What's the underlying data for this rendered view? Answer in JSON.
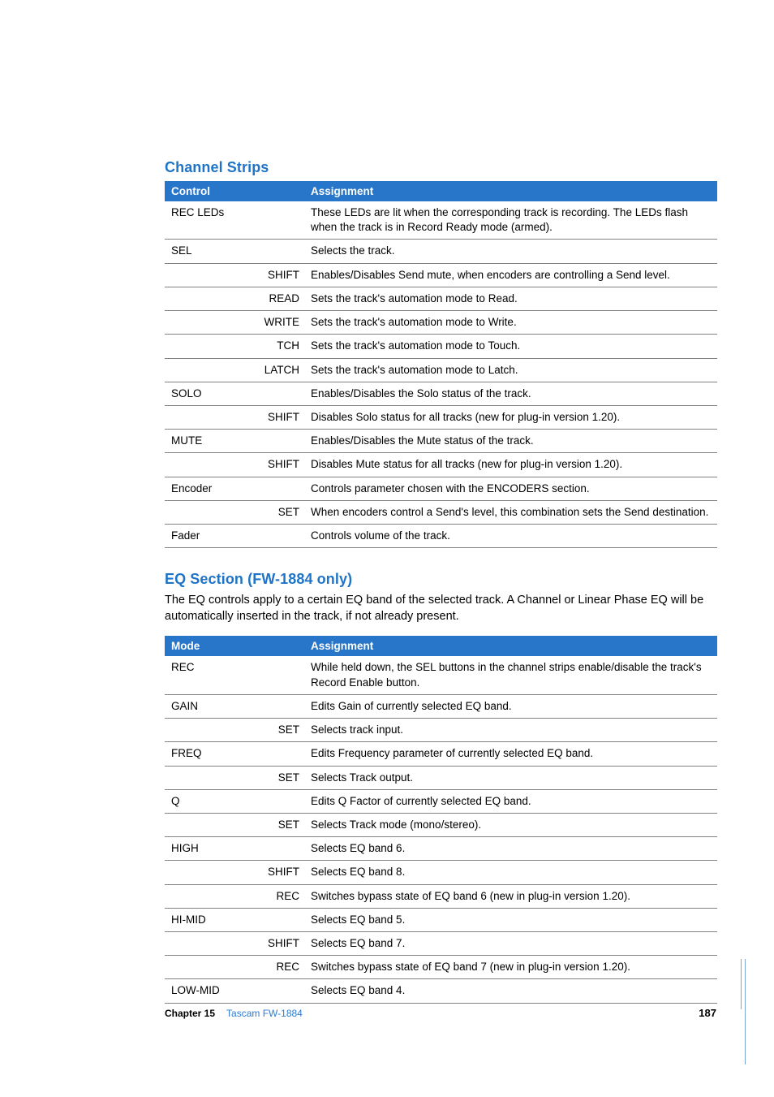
{
  "section1": {
    "heading": "Channel Strips",
    "headers": {
      "control": "Control",
      "assignment": "Assignment"
    },
    "rows": [
      {
        "control": "REC LEDs",
        "mod": "",
        "assignment": "These LEDs are lit when the corresponding track is recording. The LEDs flash when the track is in Record Ready mode (armed)."
      },
      {
        "control": "SEL",
        "mod": "",
        "assignment": "Selects the track."
      },
      {
        "control": "",
        "mod": "SHIFT",
        "assignment": "Enables/Disables Send mute, when encoders are controlling a Send level."
      },
      {
        "control": "",
        "mod": "READ",
        "assignment": "Sets the track's automation mode to Read."
      },
      {
        "control": "",
        "mod": "WRITE",
        "assignment": "Sets the track's automation mode to Write."
      },
      {
        "control": "",
        "mod": "TCH",
        "assignment": "Sets the track's automation mode to Touch."
      },
      {
        "control": "",
        "mod": "LATCH",
        "assignment": "Sets the track's automation mode to Latch."
      },
      {
        "control": "SOLO",
        "mod": "",
        "assignment": "Enables/Disables the Solo status of the track."
      },
      {
        "control": "",
        "mod": "SHIFT",
        "assignment": "Disables Solo status for all tracks (new for plug-in version 1.20)."
      },
      {
        "control": "MUTE",
        "mod": "",
        "assignment": "Enables/Disables the Mute status of the track."
      },
      {
        "control": "",
        "mod": "SHIFT",
        "assignment": "Disables Mute status for all tracks (new for plug-in version 1.20)."
      },
      {
        "control": "Encoder",
        "mod": "",
        "assignment": "Controls parameter chosen with the ENCODERS section."
      },
      {
        "control": "",
        "mod": "SET",
        "assignment": "When encoders control a Send's level, this combination sets the Send destination."
      },
      {
        "control": "Fader",
        "mod": "",
        "assignment": "Controls volume of the track."
      }
    ]
  },
  "section2": {
    "heading": "EQ Section (FW-1884 only)",
    "intro": "The EQ controls apply to a certain EQ band of the selected track. A Channel or Linear Phase EQ will be automatically inserted in the track, if not already present.",
    "headers": {
      "mode": "Mode",
      "assignment": "Assignment"
    },
    "rows": [
      {
        "mode": "REC",
        "mod": "",
        "assignment": "While held down, the SEL buttons in the channel strips enable/disable the track's Record Enable button."
      },
      {
        "mode": "GAIN",
        "mod": "",
        "assignment": "Edits Gain of currently selected EQ band."
      },
      {
        "mode": "",
        "mod": "SET",
        "assignment": "Selects track input."
      },
      {
        "mode": "FREQ",
        "mod": "",
        "assignment": "Edits Frequency parameter of currently selected EQ band."
      },
      {
        "mode": "",
        "mod": "SET",
        "assignment": "Selects Track output."
      },
      {
        "mode": "Q",
        "mod": "",
        "assignment": "Edits Q Factor of currently selected EQ band."
      },
      {
        "mode": "",
        "mod": "SET",
        "assignment": "Selects Track mode (mono/stereo)."
      },
      {
        "mode": "HIGH",
        "mod": "",
        "assignment": "Selects EQ band 6."
      },
      {
        "mode": "",
        "mod": "SHIFT",
        "assignment": "Selects EQ band 8."
      },
      {
        "mode": "",
        "mod": "REC",
        "assignment": "Switches bypass state of EQ band 6 (new in plug-in version 1.20)."
      },
      {
        "mode": "HI-MID",
        "mod": "",
        "assignment": "Selects EQ band 5."
      },
      {
        "mode": "",
        "mod": "SHIFT",
        "assignment": "Selects EQ band 7."
      },
      {
        "mode": "",
        "mod": "REC",
        "assignment": "Switches bypass state of EQ band 7 (new in plug-in version 1.20)."
      },
      {
        "mode": "LOW-MID",
        "mod": "",
        "assignment": "Selects EQ band 4."
      }
    ]
  },
  "footer": {
    "chapterLabel": "Chapter 15",
    "chapterTitle": "Tascam FW-1884",
    "pageNumber": "187"
  }
}
